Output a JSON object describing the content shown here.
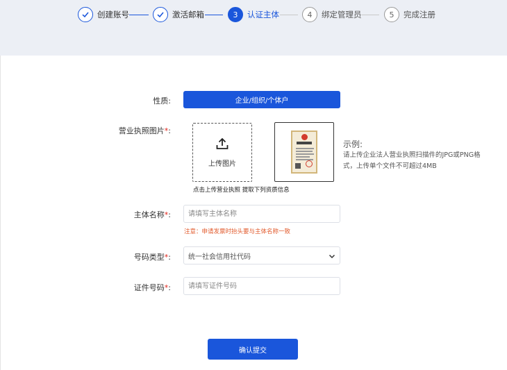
{
  "steps": [
    {
      "number": "1",
      "label": "创建账号",
      "status": "done"
    },
    {
      "number": "2",
      "label": "激活邮箱",
      "status": "done"
    },
    {
      "number": "3",
      "label": "认证主体",
      "status": "active"
    },
    {
      "number": "4",
      "label": "绑定管理员",
      "status": "todo"
    },
    {
      "number": "5",
      "label": "完成注册",
      "status": "todo"
    }
  ],
  "form": {
    "nature_label": "性质:",
    "nature_button": "企业/组织/个体户",
    "license_label": "营业执照图片",
    "required_mark": "*",
    "colon": ":",
    "upload_text": "上传图片",
    "upload_hint": "点击上传营业执照 提取下列资质信息",
    "example_title": "示例:",
    "example_desc": "请上传企业法人营业执照扫描件的JPG或PNG格式，上传单个文件不可超过4MB",
    "subject_name_label": "主体名称",
    "subject_name_placeholder": "请填写主体名称",
    "notice": "注意：申请发票时抬头要与主体名称一致",
    "code_type_label": "号码类型",
    "code_type_value": "统一社会信用社代码",
    "id_number_label": "证件号码",
    "id_number_placeholder": "请填写证件号码",
    "submit": "确认提交"
  },
  "colors": {
    "primary": "#1a56db",
    "required": "#e1251b",
    "notice": "#e25a2c",
    "header_bg": "#eceff5"
  },
  "icons": {
    "step_done": "check-icon",
    "upload": "upload-icon",
    "select": "chevron-down-icon"
  }
}
